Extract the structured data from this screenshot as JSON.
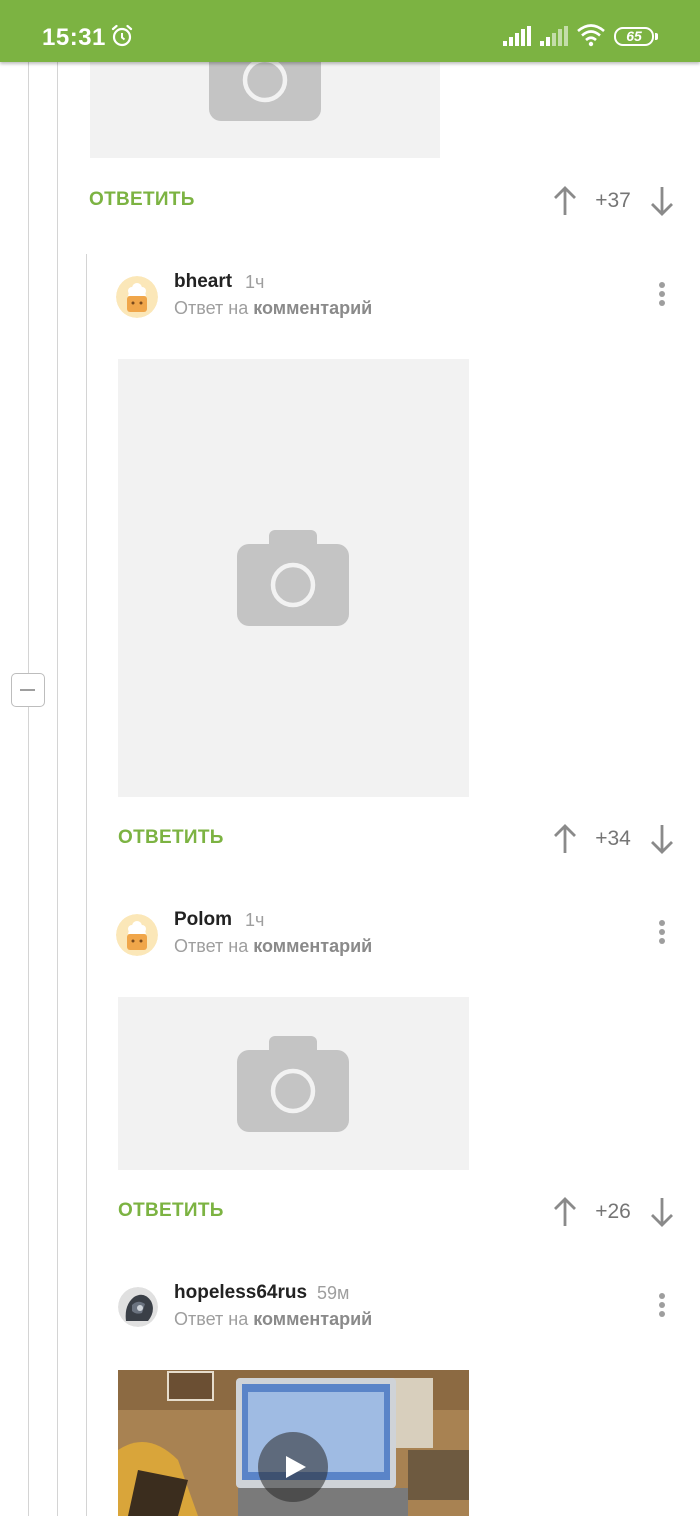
{
  "status_bar": {
    "time": "15:31",
    "battery": "65",
    "color": "#7cb342"
  },
  "icons": {
    "alarm": "alarm-clock-icon",
    "signal": "cell-signal-icon",
    "wifi": "wifi-icon",
    "camera": "camera-icon",
    "up": "arrow-up-icon",
    "down": "arrow-down-icon",
    "more": "more-vertical-icon",
    "play": "play-icon"
  },
  "accent_color": "#7cb342",
  "comments": [
    {
      "reply_label": "ОТВЕТИТЬ",
      "score": "+37"
    },
    {
      "author": "bheart",
      "time": "1ч",
      "reply_to_prefix": "Ответ на",
      "reply_to_link": "комментарий",
      "reply_label": "ОТВЕТИТЬ",
      "score": "+34"
    },
    {
      "author": "Polom",
      "time": "1ч",
      "reply_to_prefix": "Ответ на",
      "reply_to_link": "комментарий",
      "reply_label": "ОТВЕТИТЬ",
      "score": "+26"
    },
    {
      "author": "hopeless64rus",
      "time": "59м",
      "reply_to_prefix": "Ответ на",
      "reply_to_link": "комментарий"
    }
  ]
}
